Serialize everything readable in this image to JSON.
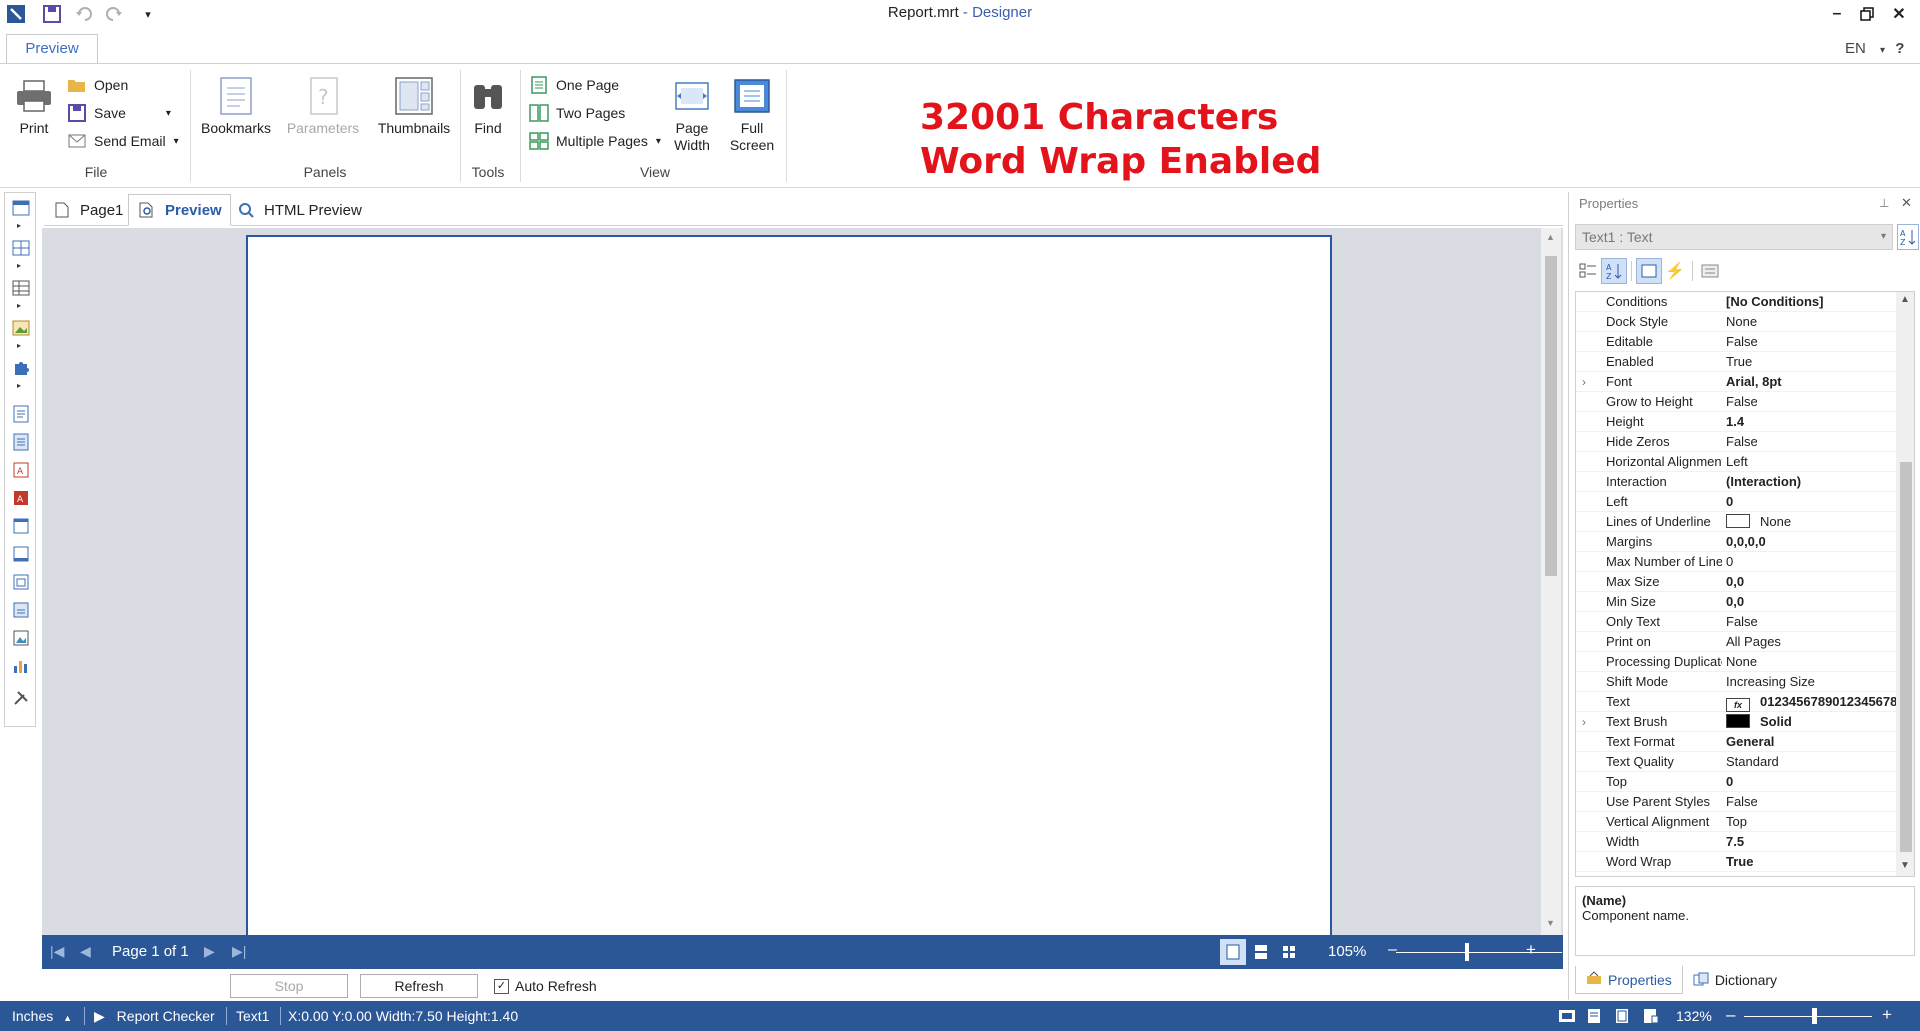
{
  "window": {
    "title": "Report.mrt",
    "subtitle": " - Designer",
    "lang": "EN"
  },
  "ribbon": {
    "tab_preview": "Preview",
    "print": "Print",
    "open": "Open",
    "save": "Save",
    "send_email": "Send Email",
    "group_file": "File",
    "bookmarks": "Bookmarks",
    "parameters": "Parameters",
    "thumbnails": "Thumbnails",
    "group_panels": "Panels",
    "find": "Find",
    "group_tools": "Tools",
    "one_page": "One Page",
    "two_pages": "Two Pages",
    "multiple_pages": "Multiple Pages",
    "page_width_1": "Page",
    "page_width_2": "Width",
    "full_screen_1": "Full",
    "full_screen_2": "Screen",
    "group_view": "View"
  },
  "note": {
    "line1": "32001 Characters",
    "line2": "Word Wrap Enabled"
  },
  "doc_tabs": [
    "Page1",
    "Preview",
    "HTML Preview"
  ],
  "navigation": {
    "page_label": "Page 1 of 1",
    "zoom": "105%",
    "zoom_level_fraction": 0.43
  },
  "buttons": {
    "stop": "Stop",
    "refresh": "Refresh",
    "auto_refresh": "Auto Refresh",
    "auto_refresh_checked": true
  },
  "properties": {
    "panel_title": "Properties",
    "selected_component": "Text1 : Text",
    "rows": [
      {
        "name": "Conditions",
        "value": "[No Conditions]",
        "bold": true
      },
      {
        "name": "Dock Style",
        "value": "None",
        "bold": false
      },
      {
        "name": "Editable",
        "value": "False",
        "bold": false
      },
      {
        "name": "Enabled",
        "value": "True",
        "bold": false
      },
      {
        "name": "Font",
        "value": "Arial, 8pt",
        "bold": true,
        "expandable": true
      },
      {
        "name": "Grow to Height",
        "value": "False",
        "bold": false
      },
      {
        "name": "Height",
        "value": "1.4",
        "bold": true
      },
      {
        "name": "Hide Zeros",
        "value": "False",
        "bold": false
      },
      {
        "name": "Horizontal Alignment",
        "value": "Left",
        "bold": false
      },
      {
        "name": "Interaction",
        "value": "(Interaction)",
        "bold": true
      },
      {
        "name": "Left",
        "value": "0",
        "bold": true
      },
      {
        "name": "Lines of Underline",
        "value": "None",
        "bold": false,
        "swatch": "#ffffff"
      },
      {
        "name": "Margins",
        "value": "0,0,0,0",
        "bold": true
      },
      {
        "name": "Max Number of Lines",
        "value": "0",
        "bold": false
      },
      {
        "name": "Max Size",
        "value": "0,0",
        "bold": true
      },
      {
        "name": "Min Size",
        "value": "0,0",
        "bold": true
      },
      {
        "name": "Only Text",
        "value": "False",
        "bold": false
      },
      {
        "name": "Print on",
        "value": "All Pages",
        "bold": false
      },
      {
        "name": "Processing Duplicates",
        "value": "None",
        "bold": false
      },
      {
        "name": "Shift Mode",
        "value": "Increasing Size",
        "bold": false
      },
      {
        "name": "Text",
        "value": "0123456789012345678",
        "bold": true,
        "fx": true
      },
      {
        "name": "Text Brush",
        "value": "Solid",
        "bold": true,
        "expandable": true,
        "swatch": "#000000"
      },
      {
        "name": "Text Format",
        "value": "General",
        "bold": true
      },
      {
        "name": "Text Quality",
        "value": "Standard",
        "bold": false
      },
      {
        "name": "Top",
        "value": "0",
        "bold": true
      },
      {
        "name": "Use Parent Styles",
        "value": "False",
        "bold": false
      },
      {
        "name": "Vertical Alignment",
        "value": "Top",
        "bold": false
      },
      {
        "name": "Width",
        "value": "7.5",
        "bold": true
      },
      {
        "name": "Word Wrap",
        "value": "True",
        "bold": true
      }
    ],
    "desc_title": "(Name)",
    "desc_text": "Component name.",
    "tab_properties": "Properties",
    "tab_dictionary": "Dictionary"
  },
  "status": {
    "units": "Inches",
    "report_checker": "Report Checker",
    "component": "Text1",
    "coords": "X:0.00  Y:0.00  Width:7.50  Height:1.40",
    "zoom": "132%",
    "zoom_level_fraction": 0.55
  },
  "colors": {
    "accent": "#2b5797",
    "note_red": "#e3131b",
    "page_border": "#2a56a2"
  }
}
